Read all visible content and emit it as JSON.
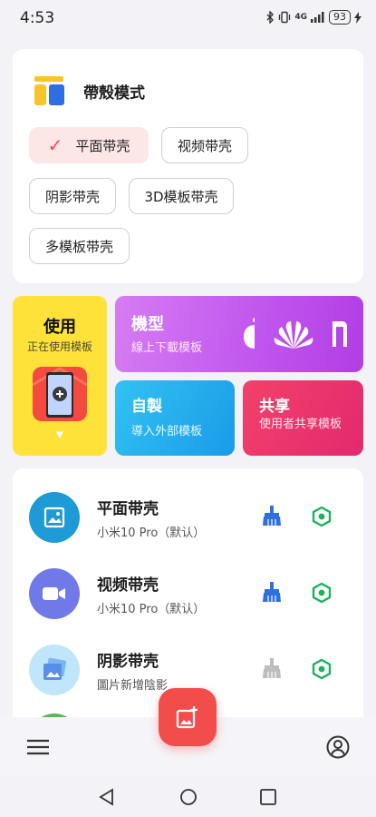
{
  "status_bar": {
    "time": "4:53",
    "network": "4G",
    "battery": "93",
    "icons": [
      "bluetooth-icon",
      "vibrate-icon",
      "signal-icon",
      "battery-icon",
      "charging-icon"
    ]
  },
  "mode_card": {
    "title": "帶殼模式",
    "options": [
      {
        "label": "平面带壳",
        "selected": true
      },
      {
        "label": "视频带壳",
        "selected": false
      },
      {
        "label": "阴影带壳",
        "selected": false
      },
      {
        "label": "3D模板带壳",
        "selected": false
      },
      {
        "label": "多模板带壳",
        "selected": false
      }
    ]
  },
  "tiles": {
    "use": {
      "title": "使用",
      "subtitle": "正在使用模板"
    },
    "model": {
      "title": "機型",
      "subtitle": "線上下載模板",
      "brands": [
        "apple-logo",
        "huawei-logo",
        "mi-logo"
      ]
    },
    "custom": {
      "title": "自製",
      "subtitle": "導入外部模板"
    },
    "share": {
      "title": "共享",
      "subtitle": "使用者共享模板"
    }
  },
  "templates": [
    {
      "title": "平面带壳",
      "subtitle": "小米10 Pro（默认）",
      "icon": "image-icon",
      "color": "#1e9ad6",
      "clean_active": true
    },
    {
      "title": "视频带壳",
      "subtitle": "小米10 Pro（默认）",
      "icon": "video-icon",
      "color": "#6f7ae8",
      "clean_active": true
    },
    {
      "title": "阴影带壳",
      "subtitle": "圖片新增陰影",
      "icon": "shadow-image-icon",
      "color": "#bfe6fb",
      "clean_active": false
    }
  ],
  "colors": {
    "accent_red": "#f24d4b",
    "selected_chip_bg": "#fde7e6",
    "hex_green": "#19b35c",
    "clean_blue": "#2f6fe0"
  }
}
